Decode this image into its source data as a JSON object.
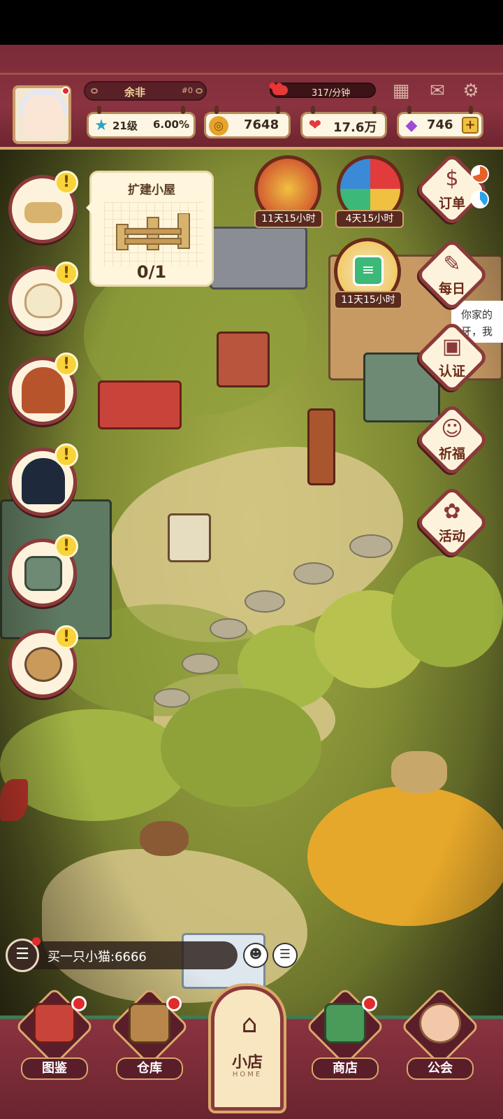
{
  "player": {
    "name": "余非",
    "id_label": "#0",
    "level_label": "21级",
    "level_progress": "6.00%",
    "avatar_has_notification": true
  },
  "header": {
    "heart_rate": "317/分钟",
    "icons": [
      "calendar-icon",
      "mail-icon",
      "settings-icon"
    ]
  },
  "currencies": {
    "coins": "7648",
    "hearts": "17.6万",
    "gems": "746",
    "add_label": "+"
  },
  "left_menu": {
    "items": [
      {
        "name": "expand-cabin",
        "alert": "!"
      },
      {
        "name": "rice-bowl",
        "alert": "!"
      },
      {
        "name": "girl-character",
        "alert": "!"
      },
      {
        "name": "boy-character",
        "alert": "!"
      },
      {
        "name": "shop-stall",
        "alert": "!"
      },
      {
        "name": "cooking-pot",
        "alert": "!"
      }
    ]
  },
  "tooltip": {
    "title": "扩建小屋",
    "progress": "0/1"
  },
  "events": [
    {
      "name": "firecracker-event",
      "timer": "11天15小时"
    },
    {
      "name": "wheel-event",
      "timer": "4天15小时"
    },
    {
      "name": "christmas-event",
      "timer": "11天15小时"
    }
  ],
  "right_menu": [
    {
      "name": "orders",
      "label": "订单"
    },
    {
      "name": "daily",
      "label": "每日"
    },
    {
      "name": "verify",
      "label": "认证"
    },
    {
      "name": "pray",
      "label": "祈福"
    },
    {
      "name": "activity",
      "label": "活动"
    }
  ],
  "speech_bubble": {
    "line1": "你家的",
    "line2": "牙，我"
  },
  "chat": {
    "message": "买一只小猫:6666"
  },
  "bottom_nav": {
    "items": [
      {
        "name": "encyclopedia",
        "label": "图鉴",
        "dot": true
      },
      {
        "name": "warehouse",
        "label": "仓库",
        "dot": true
      },
      {
        "name": "shop",
        "label": "商店",
        "dot": true
      },
      {
        "name": "guild",
        "label": "公会",
        "dot": false
      }
    ],
    "home_label": "小店",
    "home_sub": "HOME"
  },
  "colors": {
    "header_bg": "#8b3340",
    "accent_gold": "#d9a86a",
    "alert_yellow": "#f8d33a",
    "notification_red": "#e02c2c"
  }
}
